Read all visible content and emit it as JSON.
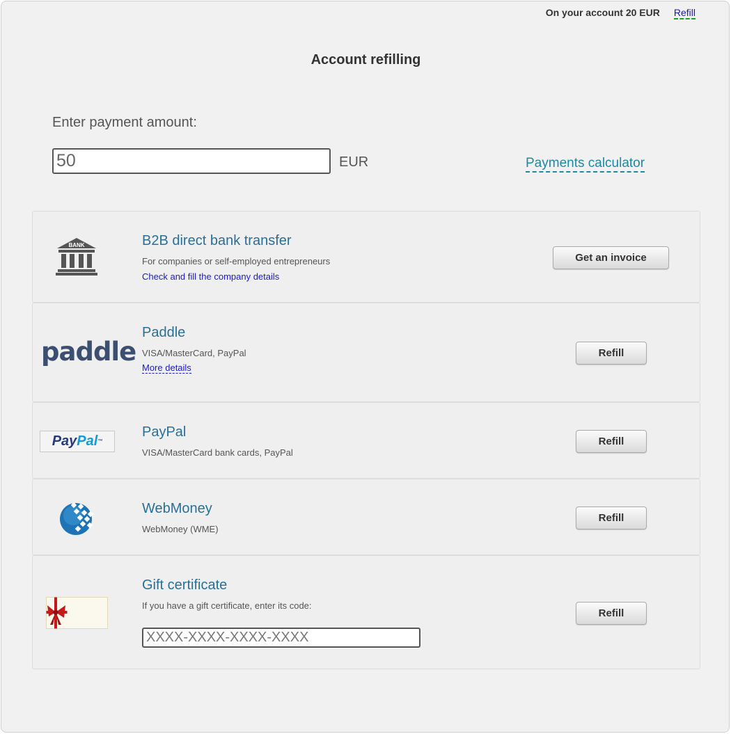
{
  "account": {
    "balance_text": "On your account 20 EUR",
    "refill_link": "Refill"
  },
  "page": {
    "title": "Account refilling"
  },
  "amount": {
    "label": "Enter payment amount:",
    "value": "50",
    "currency": "EUR",
    "calculator_link": "Payments calculator"
  },
  "methods": [
    {
      "name": "B2B direct bank transfer",
      "description": "For companies or self-employed entrepreneurs",
      "link": "Check and fill the company details",
      "button": "Get an invoice",
      "logo": "bank-icon",
      "logo_text": "BANK"
    },
    {
      "name": "Paddle",
      "description": "VISA/MasterCard, PayPal",
      "link": "More details",
      "button": "Refill",
      "logo": "paddle-logo",
      "logo_text": "paddle"
    },
    {
      "name": "PayPal",
      "description": "VISA/MasterCard bank cards, PayPal",
      "button": "Refill",
      "logo": "paypal-logo",
      "logo_text": "PayPal"
    },
    {
      "name": "WebMoney",
      "description": "WebMoney (WME)",
      "button": "Refill",
      "logo": "webmoney-globe-icon"
    },
    {
      "name": "Gift certificate",
      "description": "If you have a gift certificate, enter its code:",
      "code_placeholder": "XXXX-XXXX-XXXX-XXXX",
      "button": "Refill",
      "logo": "gift-certificate-icon"
    }
  ],
  "colors": {
    "accent": "#2a6f95",
    "link": "#1a1acc",
    "calc_link": "#1b8aa5",
    "paddle": "#3c4f70",
    "paypal_dark": "#253b80",
    "paypal_light": "#179bd7",
    "webmoney": "#1e73b5",
    "ribbon": "#c41a1a"
  }
}
